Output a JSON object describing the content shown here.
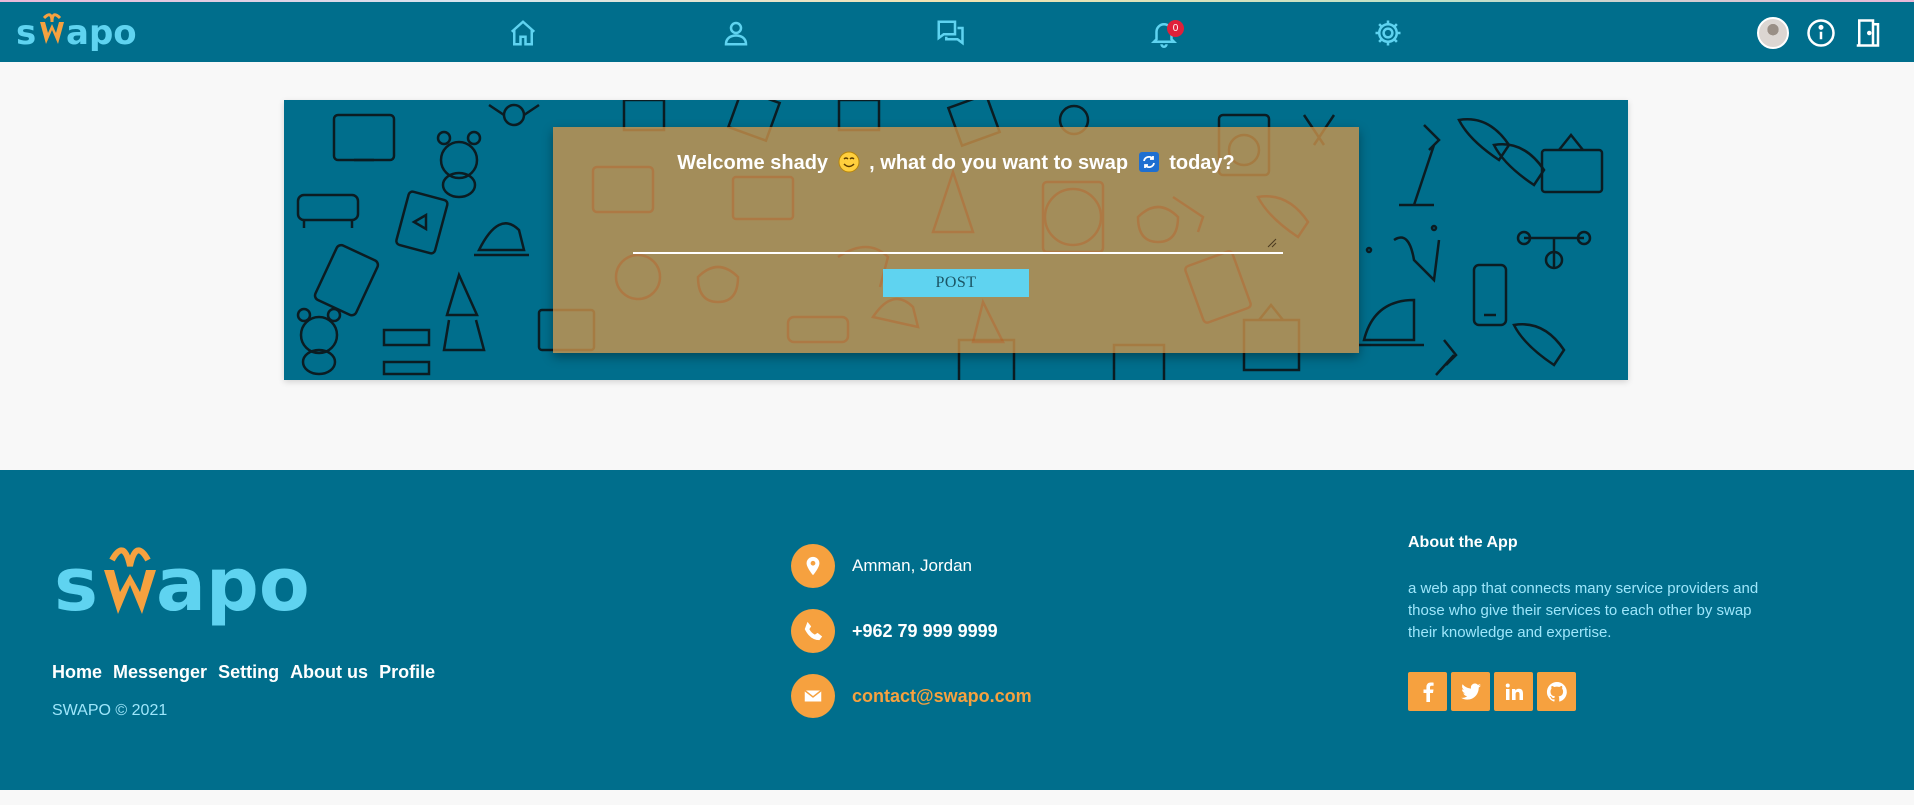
{
  "app": {
    "name": "swapo"
  },
  "nav": {
    "icons": [
      "home-icon",
      "user-icon",
      "messenger-icon",
      "bell-icon",
      "gear-icon"
    ],
    "notification_count": "0",
    "right_icons": [
      "avatar",
      "info-icon",
      "logout-door-icon"
    ]
  },
  "hero": {
    "welcome_prefix": "Welcome shady",
    "welcome_middle": ", what do you want to swap",
    "welcome_suffix": "today?",
    "post_input_value": "",
    "post_button": "POST"
  },
  "footer": {
    "links": [
      "Home",
      "Messenger",
      "Setting",
      "About us",
      "Profile"
    ],
    "copyright": "SWAPO © 2021",
    "contacts": {
      "location": "Amman, Jordan",
      "phone": "+962 79 999 9999",
      "email": "contact@swapo.com"
    },
    "about_title": "About the App",
    "about_text": "a web app that connects many service providers and those who give their services to each other by swap their knowledge and expertise.",
    "social": [
      "facebook-icon",
      "twitter-icon",
      "linkedin-icon",
      "github-icon"
    ]
  },
  "colors": {
    "primary": "#006e8c",
    "accent": "#f6a13f",
    "light_cyan": "#5fd3f0",
    "page_bg": "#f8f8f8"
  }
}
